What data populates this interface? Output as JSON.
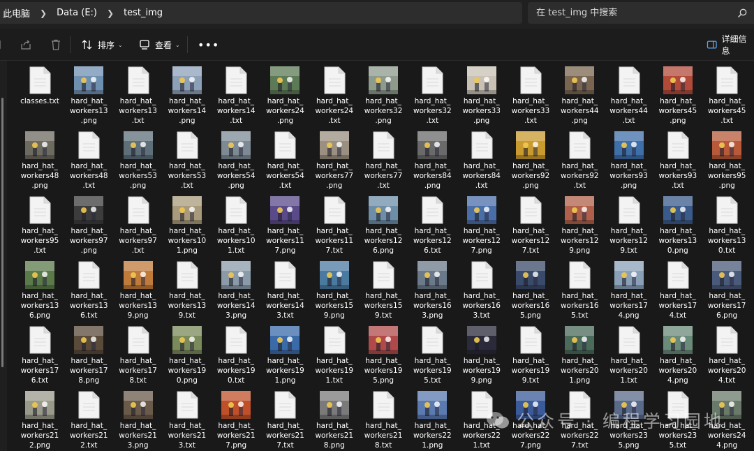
{
  "address": {
    "crumbs": [
      "此电脑",
      "Data (E:)",
      "test_img"
    ]
  },
  "search": {
    "placeholder": "在 test_img 中搜索"
  },
  "toolbar": {
    "sort_label": "排序",
    "view_label": "查看",
    "details_label": "详细信息"
  },
  "files": [
    {
      "name": "classes.txt",
      "type": "txt"
    },
    {
      "name": "hard_hat_\nworkers13\n.png",
      "type": "img",
      "color": "#6f8fb0"
    },
    {
      "name": "hard_hat_\nworkers13\n.txt",
      "type": "txt"
    },
    {
      "name": "hard_hat_\nworkers14\n.png",
      "type": "img",
      "color": "#8ca0b8"
    },
    {
      "name": "hard_hat_\nworkers14\n.txt",
      "type": "txt"
    },
    {
      "name": "hard_hat_\nworkers24\n.png",
      "type": "img",
      "color": "#5d7a56"
    },
    {
      "name": "hard_hat_\nworkers24\n.txt",
      "type": "txt"
    },
    {
      "name": "hard_hat_\nworkers32\n.png",
      "type": "img",
      "color": "#8e9a8c"
    },
    {
      "name": "hard_hat_\nworkers32\n.txt",
      "type": "txt"
    },
    {
      "name": "hard_hat_\nworkers33\n.png",
      "type": "img",
      "color": "#c9c2b4"
    },
    {
      "name": "hard_hat_\nworkers33\n.txt",
      "type": "txt"
    },
    {
      "name": "hard_hat_\nworkers44\n.png",
      "type": "img",
      "color": "#7a6650"
    },
    {
      "name": "hard_hat_\nworkers44\n.txt",
      "type": "txt"
    },
    {
      "name": "hard_hat_\nworkers45\n.png",
      "type": "img",
      "color": "#b24a3a"
    },
    {
      "name": "hard_hat_\nworkers45\n.txt",
      "type": "txt"
    },
    {
      "name": "hard_hat_\nworkers48\n.png",
      "type": "img",
      "color": "#6d6a60"
    },
    {
      "name": "hard_hat_\nworkers48\n.txt",
      "type": "txt"
    },
    {
      "name": "hard_hat_\nworkers53\n.png",
      "type": "img",
      "color": "#5f6f7a"
    },
    {
      "name": "hard_hat_\nworkers53\n.txt",
      "type": "txt"
    },
    {
      "name": "hard_hat_\nworkers54\n.png",
      "type": "img",
      "color": "#7d8a94"
    },
    {
      "name": "hard_hat_\nworkers54\n.txt",
      "type": "txt"
    },
    {
      "name": "hard_hat_\nworkers77\n.png",
      "type": "img",
      "color": "#9a8f80"
    },
    {
      "name": "hard_hat_\nworkers77\n.txt",
      "type": "txt"
    },
    {
      "name": "hard_hat_\nworkers84\n.png",
      "type": "img",
      "color": "#6a6a6a"
    },
    {
      "name": "hard_hat_\nworkers84\n.txt",
      "type": "txt"
    },
    {
      "name": "hard_hat_\nworkers92\n.png",
      "type": "img",
      "color": "#c99a2e"
    },
    {
      "name": "hard_hat_\nworkers92\n.txt",
      "type": "txt"
    },
    {
      "name": "hard_hat_\nworkers93\n.png",
      "type": "img",
      "color": "#3f6fa8"
    },
    {
      "name": "hard_hat_\nworkers93\n.txt",
      "type": "txt"
    },
    {
      "name": "hard_hat_\nworkers95\n.png",
      "type": "img",
      "color": "#b85a3a"
    },
    {
      "name": "hard_hat_\nworkers95\n.txt",
      "type": "txt"
    },
    {
      "name": "hard_hat_\nworkers97\n.png",
      "type": "img",
      "color": "#3c3c3c"
    },
    {
      "name": "hard_hat_\nworkers97\n.txt",
      "type": "txt"
    },
    {
      "name": "hard_hat_\nworkers10\n1.png",
      "type": "img",
      "color": "#a89a7a"
    },
    {
      "name": "hard_hat_\nworkers10\n1.txt",
      "type": "txt"
    },
    {
      "name": "hard_hat_\nworkers11\n7.png",
      "type": "img",
      "color": "#5a4a8a"
    },
    {
      "name": "hard_hat_\nworkers11\n7.txt",
      "type": "txt"
    },
    {
      "name": "hard_hat_\nworkers12\n6.png",
      "type": "img",
      "color": "#6e8ea8"
    },
    {
      "name": "hard_hat_\nworkers12\n6.txt",
      "type": "txt"
    },
    {
      "name": "hard_hat_\nworkers12\n7.png",
      "type": "img",
      "color": "#4a6ea8"
    },
    {
      "name": "hard_hat_\nworkers12\n7.txt",
      "type": "txt"
    },
    {
      "name": "hard_hat_\nworkers12\n9.png",
      "type": "img",
      "color": "#b0604a"
    },
    {
      "name": "hard_hat_\nworkers12\n9.txt",
      "type": "txt"
    },
    {
      "name": "hard_hat_\nworkers13\n0.png",
      "type": "img",
      "color": "#3a5a8a"
    },
    {
      "name": "hard_hat_\nworkers13\n0.txt",
      "type": "txt"
    },
    {
      "name": "hard_hat_\nworkers13\n6.png",
      "type": "img",
      "color": "#5a7a4a"
    },
    {
      "name": "hard_hat_\nworkers13\n6.txt",
      "type": "txt"
    },
    {
      "name": "hard_hat_\nworkers13\n9.png",
      "type": "img",
      "color": "#c07a3a"
    },
    {
      "name": "hard_hat_\nworkers13\n9.txt",
      "type": "txt"
    },
    {
      "name": "hard_hat_\nworkers14\n3.png",
      "type": "img",
      "color": "#8a9aa8"
    },
    {
      "name": "hard_hat_\nworkers14\n3.txt",
      "type": "txt"
    },
    {
      "name": "hard_hat_\nworkers15\n9.png",
      "type": "img",
      "color": "#4a7aa0"
    },
    {
      "name": "hard_hat_\nworkers15\n9.txt",
      "type": "txt"
    },
    {
      "name": "hard_hat_\nworkers16\n3.png",
      "type": "img",
      "color": "#6a7a8a"
    },
    {
      "name": "hard_hat_\nworkers16\n3.txt",
      "type": "txt"
    },
    {
      "name": "hard_hat_\nworkers16\n5.png",
      "type": "img",
      "color": "#3a4a6a"
    },
    {
      "name": "hard_hat_\nworkers16\n5.txt",
      "type": "txt"
    },
    {
      "name": "hard_hat_\nworkers17\n4.png",
      "type": "img",
      "color": "#8aa0b8"
    },
    {
      "name": "hard_hat_\nworkers17\n4.txt",
      "type": "txt"
    },
    {
      "name": "hard_hat_\nworkers17\n6.png",
      "type": "img",
      "color": "#4a5a7a"
    },
    {
      "name": "hard_hat_\nworkers17\n6.txt",
      "type": "txt"
    },
    {
      "name": "hard_hat_\nworkers17\n8.png",
      "type": "img",
      "color": "#5a4a3a"
    },
    {
      "name": "hard_hat_\nworkers17\n8.txt",
      "type": "txt"
    },
    {
      "name": "hard_hat_\nworkers19\n0.png",
      "type": "img",
      "color": "#7a8a5a"
    },
    {
      "name": "hard_hat_\nworkers19\n0.txt",
      "type": "txt"
    },
    {
      "name": "hard_hat_\nworkers19\n1.png",
      "type": "img",
      "color": "#3a6aa8"
    },
    {
      "name": "hard_hat_\nworkers19\n1.txt",
      "type": "txt"
    },
    {
      "name": "hard_hat_\nworkers19\n5.png",
      "type": "img",
      "color": "#b04a4a"
    },
    {
      "name": "hard_hat_\nworkers19\n5.txt",
      "type": "txt"
    },
    {
      "name": "hard_hat_\nworkers19\n9.png",
      "type": "img",
      "color": "#2a2a3a"
    },
    {
      "name": "hard_hat_\nworkers19\n9.txt",
      "type": "txt"
    },
    {
      "name": "hard_hat_\nworkers20\n1.png",
      "type": "img",
      "color": "#4a6a5a"
    },
    {
      "name": "hard_hat_\nworkers20\n1.txt",
      "type": "txt"
    },
    {
      "name": "hard_hat_\nworkers20\n4.png",
      "type": "img",
      "color": "#6a8a7a"
    },
    {
      "name": "hard_hat_\nworkers20\n4.txt",
      "type": "txt"
    },
    {
      "name": "hard_hat_\nworkers21\n2.png",
      "type": "img",
      "color": "#9a9a8a"
    },
    {
      "name": "hard_hat_\nworkers21\n2.txt",
      "type": "txt"
    },
    {
      "name": "hard_hat_\nworkers21\n3.png",
      "type": "img",
      "color": "#6a5a4a"
    },
    {
      "name": "hard_hat_\nworkers21\n3.txt",
      "type": "txt"
    },
    {
      "name": "hard_hat_\nworkers21\n7.png",
      "type": "img",
      "color": "#c0502a"
    },
    {
      "name": "hard_hat_\nworkers21\n7.txt",
      "type": "txt"
    },
    {
      "name": "hard_hat_\nworkers21\n8.png",
      "type": "img",
      "color": "#7a7a7a"
    },
    {
      "name": "hard_hat_\nworkers21\n8.txt",
      "type": "txt"
    },
    {
      "name": "hard_hat_\nworkers22\n1.png",
      "type": "img",
      "color": "#5a7ab0"
    },
    {
      "name": "hard_hat_\nworkers22\n1.txt",
      "type": "txt"
    },
    {
      "name": "hard_hat_\nworkers22\n7.png",
      "type": "img",
      "color": "#3a5a9a"
    },
    {
      "name": "hard_hat_\nworkers22\n7.txt",
      "type": "txt"
    },
    {
      "name": "hard_hat_\nworkers23\n5.png",
      "type": "img",
      "color": "#5a6a8a"
    },
    {
      "name": "hard_hat_\nworkers23\n5.txt",
      "type": "txt"
    },
    {
      "name": "hard_hat_\nworkers24\n4.png",
      "type": "img",
      "color": "#6a7a6a"
    }
  ],
  "watermark": {
    "text": "公众号 · 编程学习园地"
  }
}
